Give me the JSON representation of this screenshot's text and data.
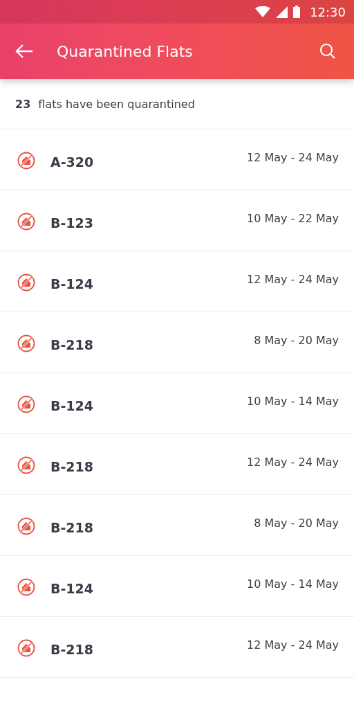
{
  "status_bar": {
    "time": "12:30"
  },
  "app_bar": {
    "title": "Quarantined Flats"
  },
  "summary": "**23** flats have been quarantined",
  "flats": [
    {
      "name": "A-320",
      "dates": "12 May - 24 May"
    },
    {
      "name": "B-123",
      "dates": "10 May - 22 May"
    },
    {
      "name": "B-124",
      "dates": "12 May - 24 May"
    },
    {
      "name": "B-218",
      "dates": "8 May - 20 May"
    },
    {
      "name": "B-124",
      "dates": "10 May - 14 May"
    },
    {
      "name": "B-218",
      "dates": "12 May - 24 May"
    },
    {
      "name": "B-218",
      "dates": "8 May - 20 May"
    },
    {
      "name": "B-124",
      "dates": "10 May - 14 May"
    },
    {
      "name": "B-218",
      "dates": "12 May - 24 May"
    }
  ]
}
